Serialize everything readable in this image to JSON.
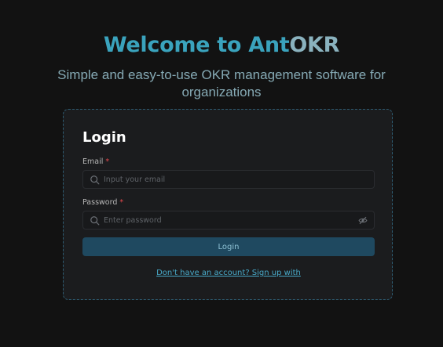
{
  "hero": {
    "title_main": "Welcome to Ant",
    "title_tail": "OKR",
    "subtitle": "Simple and easy-to-use OKR management software for organizations"
  },
  "login": {
    "title": "Login",
    "email": {
      "label": "Email",
      "required_mark": "*",
      "placeholder": "Input your email",
      "value": ""
    },
    "password": {
      "label": "Password",
      "required_mark": "*",
      "placeholder": "Enter password",
      "value": ""
    },
    "submit_label": "Login",
    "signup_link": "Don't have an account? Sign up with"
  },
  "icons": {
    "email_leading": "search-icon",
    "password_leading": "search-icon",
    "password_toggle": "eye-slash-icon"
  },
  "colors": {
    "background": "#121212",
    "title_accent": "#3aa3bd",
    "title_tail": "#8ab2be",
    "subtitle": "#86aab5",
    "card_bg": "#1b1c1e",
    "card_border": "#2e5c72",
    "button_bg": "#1f4960",
    "button_text": "#8fc3d6",
    "link": "#48a9c8",
    "required": "#e5484d"
  }
}
